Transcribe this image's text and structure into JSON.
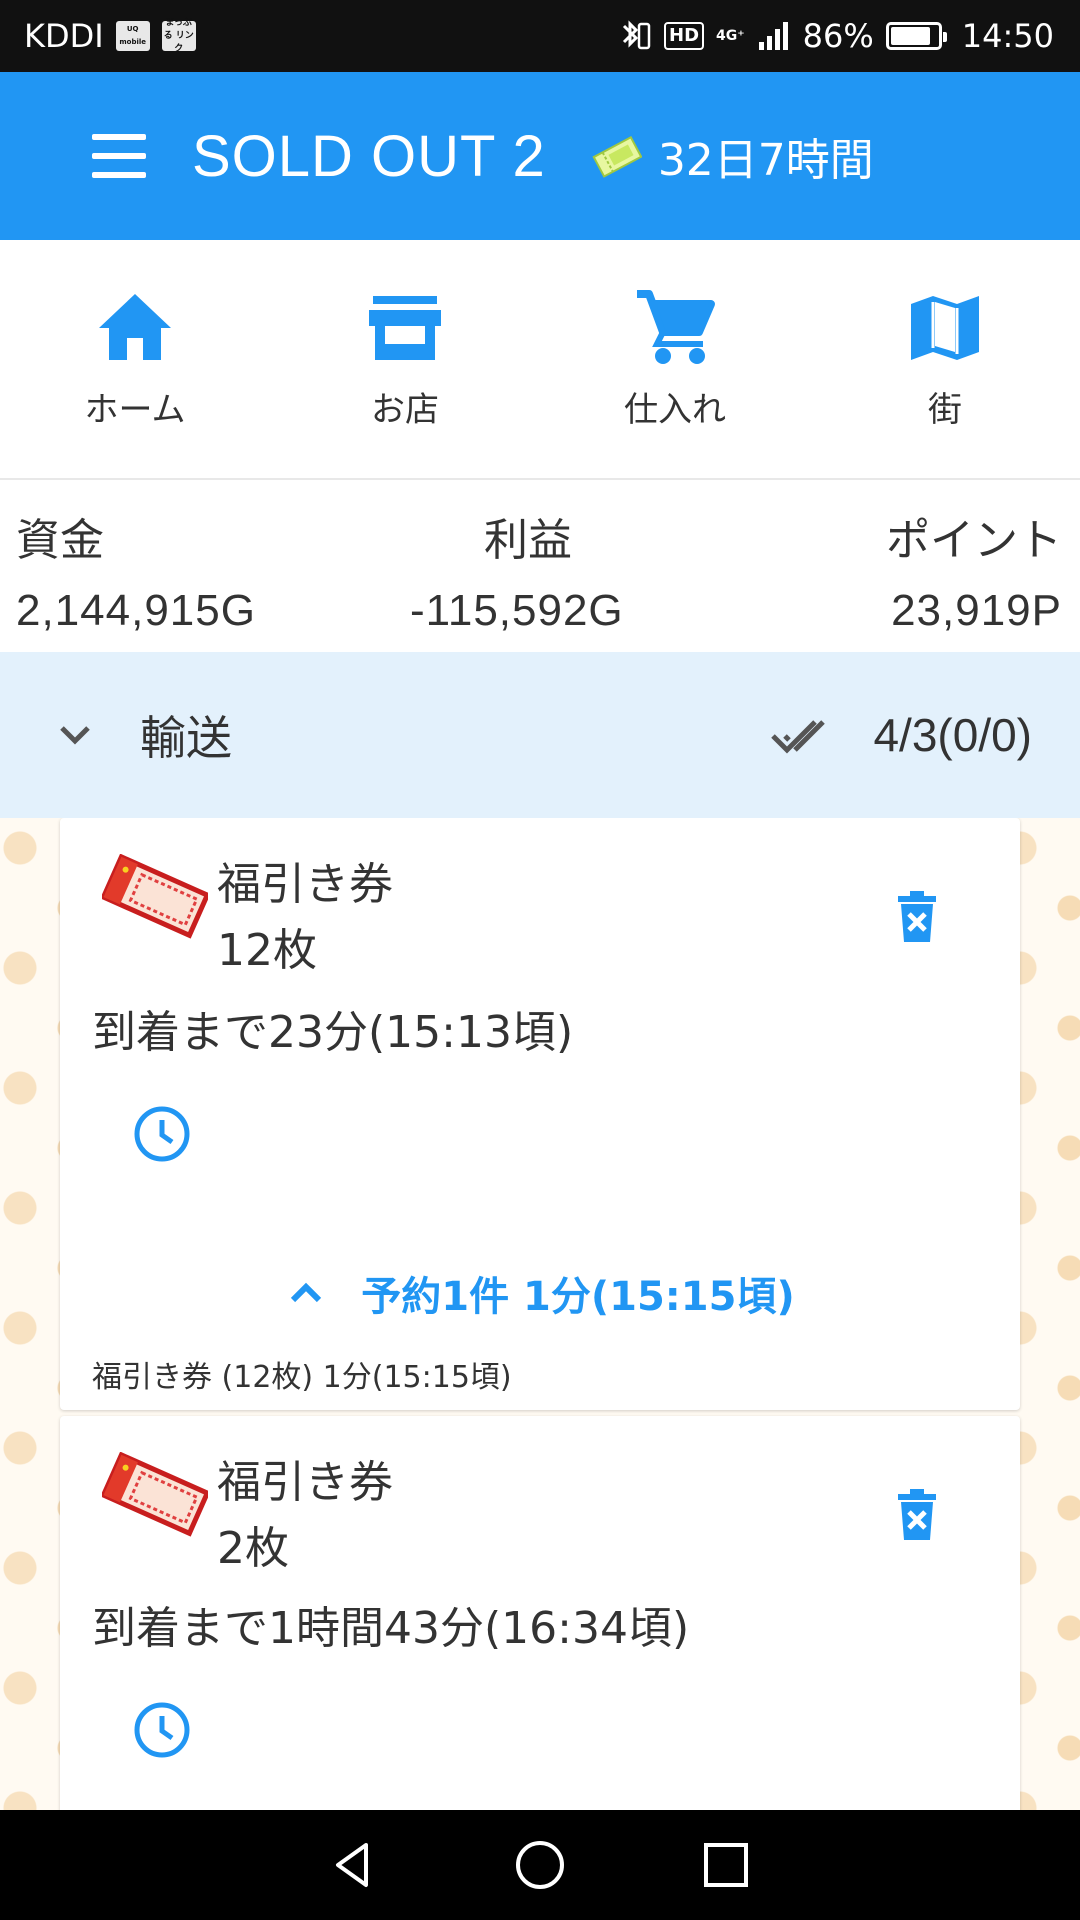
{
  "status_bar": {
    "carrier": "KDDI",
    "tile1": "UQ mobile",
    "tile2": "まっぷる リンク",
    "hd": "HD",
    "network": "4G⁺",
    "battery_percent": "86%",
    "battery_level": 0.86,
    "time": "14:50"
  },
  "app_bar": {
    "title": "SOLD OUT 2",
    "time_left": "32日7時間"
  },
  "nav": {
    "items": [
      {
        "label": "ホーム",
        "icon": "home-icon"
      },
      {
        "label": "お店",
        "icon": "store-icon"
      },
      {
        "label": "仕入れ",
        "icon": "cart-icon"
      },
      {
        "label": "街",
        "icon": "map-icon"
      }
    ]
  },
  "stats": {
    "funds_label": "資金",
    "funds_value": "2,144,915G",
    "profit_label": "利益",
    "profit_value": "-115,592G",
    "points_label": "ポイント",
    "points_value": "23,919P"
  },
  "transport": {
    "title": "輸送",
    "count": "4/3(0/0)"
  },
  "shipments": [
    {
      "item_name": "福引き券",
      "quantity": "12枚",
      "arrival": "到着まで23分(15:13頃)",
      "reservation_summary": "予約1件 1分(15:15頃)",
      "reservation_detail": "福引き券 (12枚) 1分(15:15頃)"
    },
    {
      "item_name": "福引き券",
      "quantity": "2枚",
      "arrival": "到着まで1時間43分(16:34頃)"
    }
  ],
  "colors": {
    "primary": "#2196f3",
    "transport_bg": "#e3f1fc"
  }
}
